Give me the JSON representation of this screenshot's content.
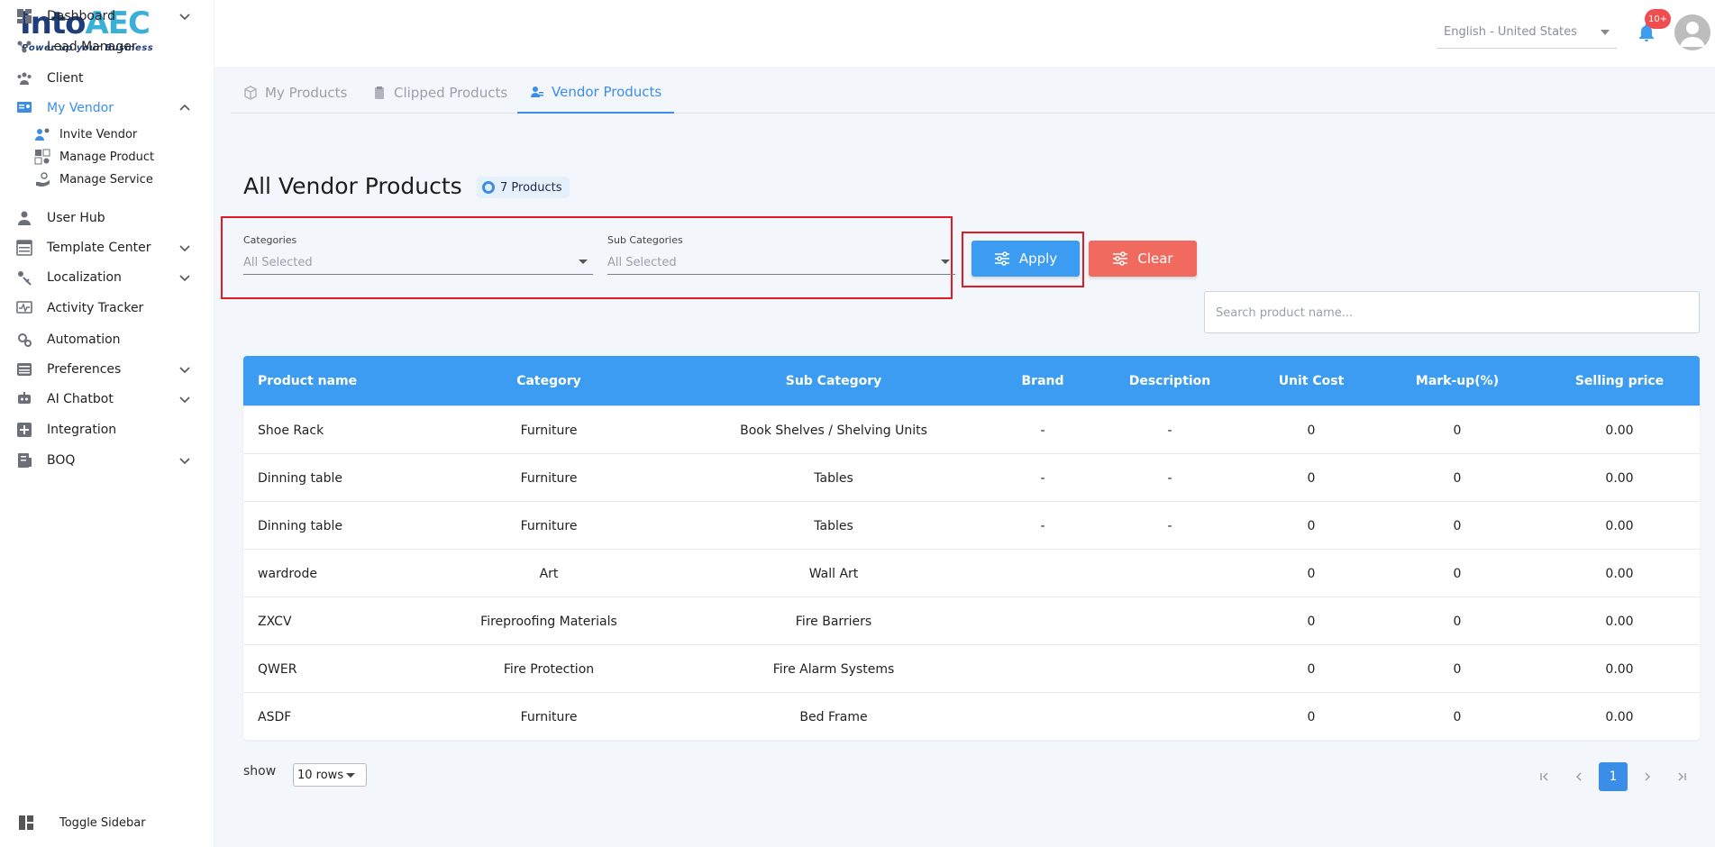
{
  "logo": {
    "main_a": "Into",
    "main_b": "AEC",
    "tagline": "Power up your Business"
  },
  "sidebar": {
    "items": [
      {
        "label": "Dashboard",
        "icon": "dashboard-icon",
        "has_chevron": true
      },
      {
        "label": "Lead Manager",
        "icon": "lead-manager-icon",
        "has_chevron": false
      },
      {
        "label": "Client",
        "icon": "client-icon",
        "has_chevron": false
      },
      {
        "label": "My Vendor",
        "icon": "vendor-icon",
        "has_chevron": true,
        "expanded": true,
        "active": true
      },
      {
        "label": "User Hub",
        "icon": "user-icon",
        "has_chevron": false
      },
      {
        "label": "Template Center",
        "icon": "template-icon",
        "has_chevron": true
      },
      {
        "label": "Localization",
        "icon": "localization-icon",
        "has_chevron": true
      },
      {
        "label": "Activity Tracker",
        "icon": "activity-icon",
        "has_chevron": false
      },
      {
        "label": "Automation",
        "icon": "automation-icon",
        "has_chevron": false
      },
      {
        "label": "Preferences",
        "icon": "preferences-icon",
        "has_chevron": true
      },
      {
        "label": "AI Chatbot",
        "icon": "chatbot-icon",
        "has_chevron": true
      },
      {
        "label": "Integration",
        "icon": "integration-icon",
        "has_chevron": false
      },
      {
        "label": "BOQ",
        "icon": "boq-icon",
        "has_chevron": true
      }
    ],
    "sub_items": [
      {
        "label": "Invite Vendor",
        "icon": "invite-vendor-icon"
      },
      {
        "label": "Manage Product",
        "icon": "manage-product-icon"
      },
      {
        "label": "Manage Service",
        "icon": "manage-service-icon"
      }
    ],
    "toggle_label": "Toggle Sidebar"
  },
  "header": {
    "language": "English - United States",
    "notification_count": "10+"
  },
  "tabs": [
    {
      "label": "My Products",
      "icon": "box-icon"
    },
    {
      "label": "Clipped Products",
      "icon": "clip-icon"
    },
    {
      "label": "Vendor Products",
      "icon": "vendor-user-icon",
      "active": true
    }
  ],
  "page": {
    "title": "All Vendor Products",
    "count": "7 Products"
  },
  "filters": {
    "categories": {
      "label": "Categories",
      "value": "All Selected"
    },
    "sub_categories": {
      "label": "Sub Categories",
      "value": "All Selected"
    },
    "apply_label": "Apply",
    "clear_label": "Clear",
    "search_placeholder": "Search product name..."
  },
  "table": {
    "headers": [
      "Product name",
      "Category",
      "Sub Category",
      "Brand",
      "Description",
      "Unit Cost",
      "Mark-up(%)",
      "Selling price"
    ],
    "rows": [
      [
        "Shoe Rack",
        "Furniture",
        "Book Shelves / Shelving Units",
        "-",
        "-",
        "0",
        "0",
        "0.00"
      ],
      [
        "Dinning table",
        "Furniture",
        "Tables",
        "-",
        "-",
        "0",
        "0",
        "0.00"
      ],
      [
        "Dinning table",
        "Furniture",
        "Tables",
        "-",
        "-",
        "0",
        "0",
        "0.00"
      ],
      [
        "wardrode",
        "Art",
        "Wall Art",
        "",
        "",
        "0",
        "0",
        "0.00"
      ],
      [
        "ZXCV",
        "Fireproofing Materials",
        "Fire Barriers",
        "",
        "",
        "0",
        "0",
        "0.00"
      ],
      [
        "QWER",
        "Fire Protection",
        "Fire Alarm Systems",
        "",
        "",
        "0",
        "0",
        "0.00"
      ],
      [
        "ASDF",
        "Furniture",
        "Bed Frame",
        "",
        "",
        "0",
        "0",
        "0.00"
      ]
    ]
  },
  "footer": {
    "show_label": "show",
    "rows_value": "10 rows",
    "current_page": "1"
  },
  "colors": {
    "accent": "#3b8ee8",
    "table_header": "#3b9cf2",
    "clear_button": "#f06a5f",
    "highlight_border": "#e01b24",
    "badge": "#f04e4e"
  }
}
